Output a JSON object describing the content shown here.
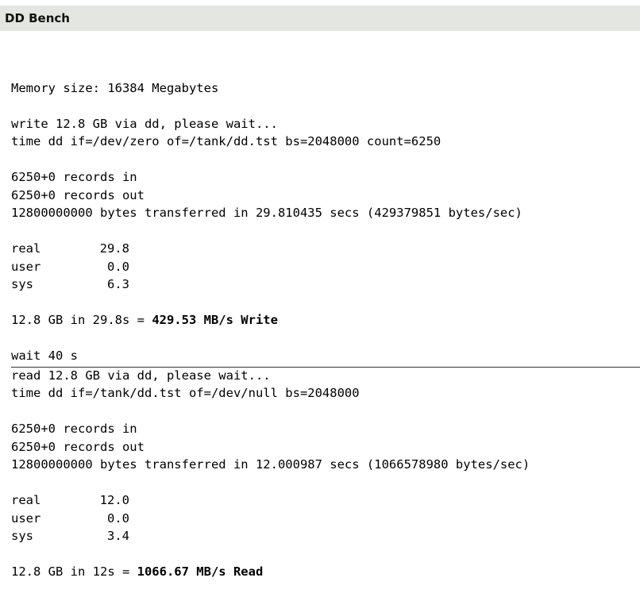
{
  "window": {
    "title": "DD Bench"
  },
  "memory_line": "Memory size: 16384 Megabytes",
  "write": {
    "status": "write 12.8 GB via dd, please wait...",
    "command": "time dd if=/dev/zero of=/tank/dd.tst bs=2048000 count=6250",
    "records_in": "6250+0 records in",
    "records_out": "6250+0 records out",
    "transferred": "12800000000 bytes transferred in 29.810435 secs (429379851 bytes/sec)",
    "timing": {
      "real_label": "real",
      "real_value": "29.8",
      "user_label": "user",
      "user_value": "0.0",
      "sys_label": "sys",
      "sys_value": "6.3"
    },
    "summary_prefix": "12.8 GB in 29.8s = ",
    "summary_result": "429.53 MB/s Write"
  },
  "wait_line": "wait 40 s",
  "read": {
    "status": "read 12.8 GB via dd, please wait...",
    "command": "time dd if=/tank/dd.tst of=/dev/null bs=2048000",
    "records_in": "6250+0 records in",
    "records_out": "6250+0 records out",
    "transferred": "12800000000 bytes transferred in 12.000987 secs (1066578980 bytes/sec)",
    "timing": {
      "real_label": "real",
      "real_value": "12.0",
      "user_label": "user",
      "user_value": "0.0",
      "sys_label": "sys",
      "sys_value": "3.4"
    },
    "summary_prefix": "12.8 GB in 12s = ",
    "summary_result": "1066.67 MB/s Read"
  }
}
